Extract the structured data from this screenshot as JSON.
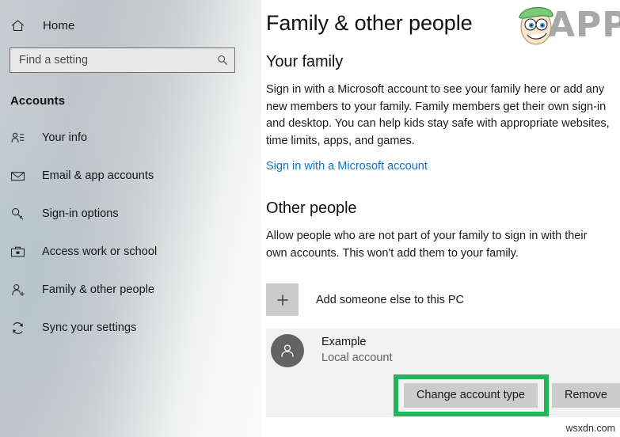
{
  "sidebar": {
    "home": {
      "label": "Home",
      "icon": "home-icon"
    },
    "search": {
      "value": "",
      "placeholder": "Find a setting",
      "icon": "search-icon"
    },
    "section_title": "Accounts",
    "items": [
      {
        "label": "Your info",
        "icon": "person-info-icon"
      },
      {
        "label": "Email & app accounts",
        "icon": "envelope-icon"
      },
      {
        "label": "Sign-in options",
        "icon": "key-icon"
      },
      {
        "label": "Access work or school",
        "icon": "briefcase-icon"
      },
      {
        "label": "Family & other people",
        "icon": "person-add-icon"
      },
      {
        "label": "Sync your settings",
        "icon": "sync-icon"
      }
    ]
  },
  "main": {
    "page_title": "Family & other people",
    "family": {
      "heading": "Your family",
      "description": "Sign in with a Microsoft account to see your family here or add any\nnew members to your family. Family members get their own sign-in\nand desktop. You can help kids stay safe with appropriate websites,\ntime limits, apps, and games.",
      "link": "Sign in with a Microsoft account"
    },
    "other_people": {
      "heading": "Other people",
      "description": "Allow people who are not part of your family to sign in with their\nown accounts. This won't add them to your family.",
      "add_button": {
        "label": "Add someone else to this PC",
        "icon": "plus-icon"
      },
      "account": {
        "name": "Example",
        "type": "Local account",
        "avatar_icon": "person-avatar-icon"
      },
      "actions": {
        "change_account_type": "Change account type",
        "remove": "Remove"
      }
    }
  },
  "annotations": {
    "highlight_color": "#26b45a",
    "highlight_target": "change-account-type-button"
  },
  "watermarks": {
    "brand": "APPUALS",
    "site": "wsxdn.com"
  },
  "colors": {
    "link": "#0b73c4",
    "button_face": "#cccccc",
    "row_background": "#f2f2f2",
    "avatar": "#636363"
  }
}
